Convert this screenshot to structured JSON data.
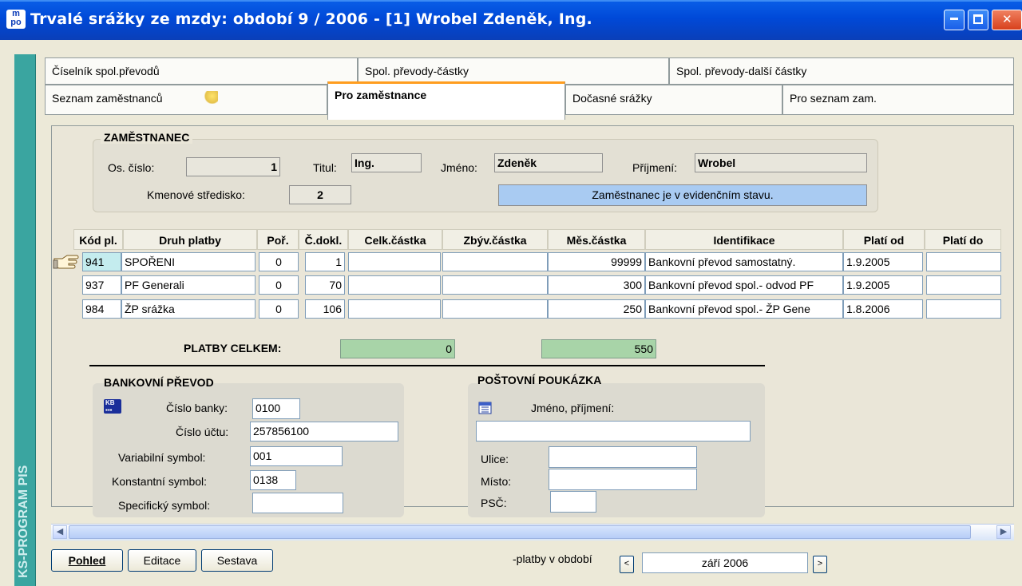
{
  "window": {
    "title": "Trvalé srážky ze mzdy: období 9 / 2006 - [1] Wrobel Zdeněk, Ing.",
    "app_icon_text": [
      "m",
      "po"
    ],
    "side_label": "KS-PROGRAM PIS"
  },
  "tabs_row1": [
    "Číselník spol.převodů",
    "Spol. převody-částky",
    "Spol. převody-další částky"
  ],
  "tabs_row2": [
    "Seznam zaměstnanců",
    "Pro zaměstnance",
    "Dočasné srážky",
    "Pro seznam zam."
  ],
  "employee": {
    "section_title": "ZAMĚSTNANEC",
    "os_cislo_label": "Os. číslo:",
    "os_cislo": "1",
    "titul_label": "Titul:",
    "titul": "Ing.",
    "jmeno_label": "Jméno:",
    "jmeno": "Zdeněk",
    "prijmeni_label": "Příjmení:",
    "prijmeni": "Wrobel",
    "stredisko_label": "Kmenové středisko:",
    "stredisko": "2",
    "status": "Zaměstnanec je v evidenčním stavu."
  },
  "table": {
    "headers": [
      "Kód pl.",
      "Druh platby",
      "Poř.",
      "Č.dokl.",
      "Celk.částka",
      "Zbýv.částka",
      "Měs.částka",
      "Identifikace",
      "Platí od",
      "Platí do"
    ],
    "rows": [
      {
        "kod": "941",
        "druh": "SPOŘENI",
        "por": "0",
        "dokl": "1",
        "celk": "",
        "zbyv": "",
        "mes": "99999",
        "ident": "Bankovní převod samostatný.",
        "od": "1.9.2005",
        "do": ""
      },
      {
        "kod": "937",
        "druh": "PF Generali",
        "por": "0",
        "dokl": "70",
        "celk": "",
        "zbyv": "",
        "mes": "300",
        "ident": "Bankovní převod spol.- odvod PF",
        "od": "1.9.2005",
        "do": ""
      },
      {
        "kod": "984",
        "druh": "ŽP srážka",
        "por": "0",
        "dokl": "106",
        "celk": "",
        "zbyv": "",
        "mes": "250",
        "ident": "Bankovní převod spol.- ŽP Gene",
        "od": "1.8.2006",
        "do": ""
      }
    ]
  },
  "totals": {
    "label": "PLATBY CELKEM:",
    "celk": "0",
    "mes": "550"
  },
  "bank": {
    "title": "BANKOVNÍ PŘEVOD",
    "cislo_banky_label": "Číslo banky:",
    "cislo_banky": "0100",
    "cislo_uctu_label": "Číslo účtu:",
    "cislo_uctu": "257856100",
    "vs_label": "Variabilní symbol:",
    "vs": "001",
    "ks_label": "Konstantní symbol:",
    "ks": "0138",
    "ss_label": "Specifický symbol:",
    "ss": ""
  },
  "postal": {
    "title": "POŠTOVNÍ POUKÁZKA",
    "jmeno_label": "Jméno, příjmení:",
    "jmeno": "",
    "ulice_label": "Ulice:",
    "ulice": "",
    "misto_label": "Místo:",
    "misto": "",
    "psc_label": "PSČ:",
    "psc": ""
  },
  "bottom": {
    "pohled": "Pohled",
    "editace": "Editace",
    "sestava": "Sestava",
    "period_label": "-platby v období",
    "period_value": "září 2006"
  },
  "colors": {
    "title_bar": "#0a5fe8",
    "side_strip": "#3aa5a0",
    "status_bar": "#a9cbf2",
    "totals_fill": "#a8d4a8",
    "active_tab_accent": "#ff9d1f"
  }
}
